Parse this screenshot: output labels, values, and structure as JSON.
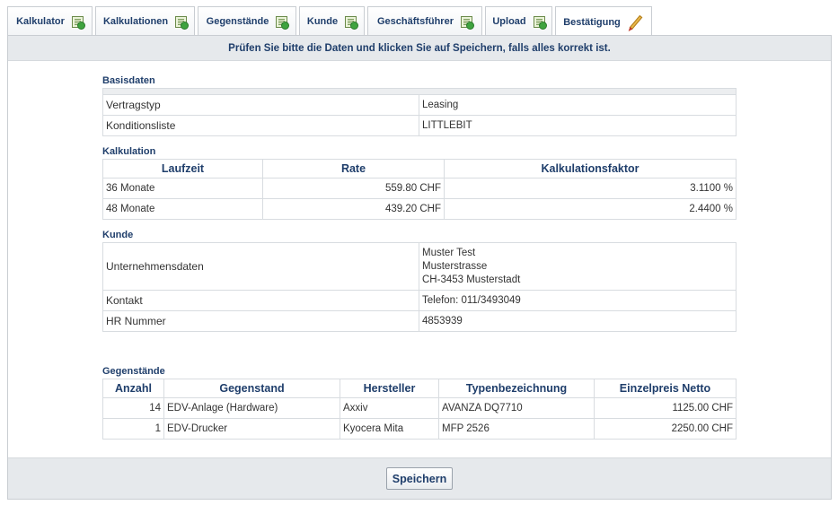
{
  "tabs": [
    {
      "label": "Kalkulator",
      "icon": "document-check-icon"
    },
    {
      "label": "Kalkulationen",
      "icon": "document-check-icon"
    },
    {
      "label": "Gegenstände",
      "icon": "document-check-icon"
    },
    {
      "label": "Kunde",
      "icon": "document-check-icon"
    },
    {
      "label": "Geschäftsführer",
      "icon": "document-check-icon"
    },
    {
      "label": "Upload",
      "icon": "document-check-icon"
    },
    {
      "label": "Bestätigung",
      "icon": "pencil-icon"
    }
  ],
  "notice": "Prüfen Sie bitte die Daten und klicken Sie auf Speichern, falls alles korrekt ist.",
  "basisdaten": {
    "title": "Basisdaten",
    "rows": [
      {
        "key": "Vertragstyp",
        "value": "Leasing"
      },
      {
        "key": "Konditionsliste",
        "value": "LITTLEBIT"
      }
    ]
  },
  "kalkulation": {
    "title": "Kalkulation",
    "headers": [
      "Laufzeit",
      "Rate",
      "Kalkulationsfaktor"
    ],
    "rows": [
      [
        "36 Monate",
        "559.80 CHF",
        "3.1100 %"
      ],
      [
        "48 Monate",
        "439.20 CHF",
        "2.4400 %"
      ]
    ]
  },
  "kunde": {
    "title": "Kunde",
    "unternehmen_label": "Unternehmensdaten",
    "unternehmen_lines": [
      "Muster Test",
      "Musterstrasse",
      "CH-3453 Musterstadt"
    ],
    "kontakt_label": "Kontakt",
    "kontakt_value": "Telefon: 011/3493049",
    "hr_label": "HR Nummer",
    "hr_value": "4853939"
  },
  "gegenstaende": {
    "title": "Gegenstände",
    "headers": [
      "Anzahl",
      "Gegenstand",
      "Hersteller",
      "Typenbezeichnung",
      "Einzelpreis Netto"
    ],
    "rows": [
      [
        "14",
        "EDV-Anlage (Hardware)",
        "Axxiv",
        "AVANZA DQ7710",
        "1125.00 CHF"
      ],
      [
        "1",
        "EDV-Drucker",
        "Kyocera Mita",
        "MFP 2526",
        "2250.00 CHF"
      ]
    ]
  },
  "save_label": "Speichern"
}
